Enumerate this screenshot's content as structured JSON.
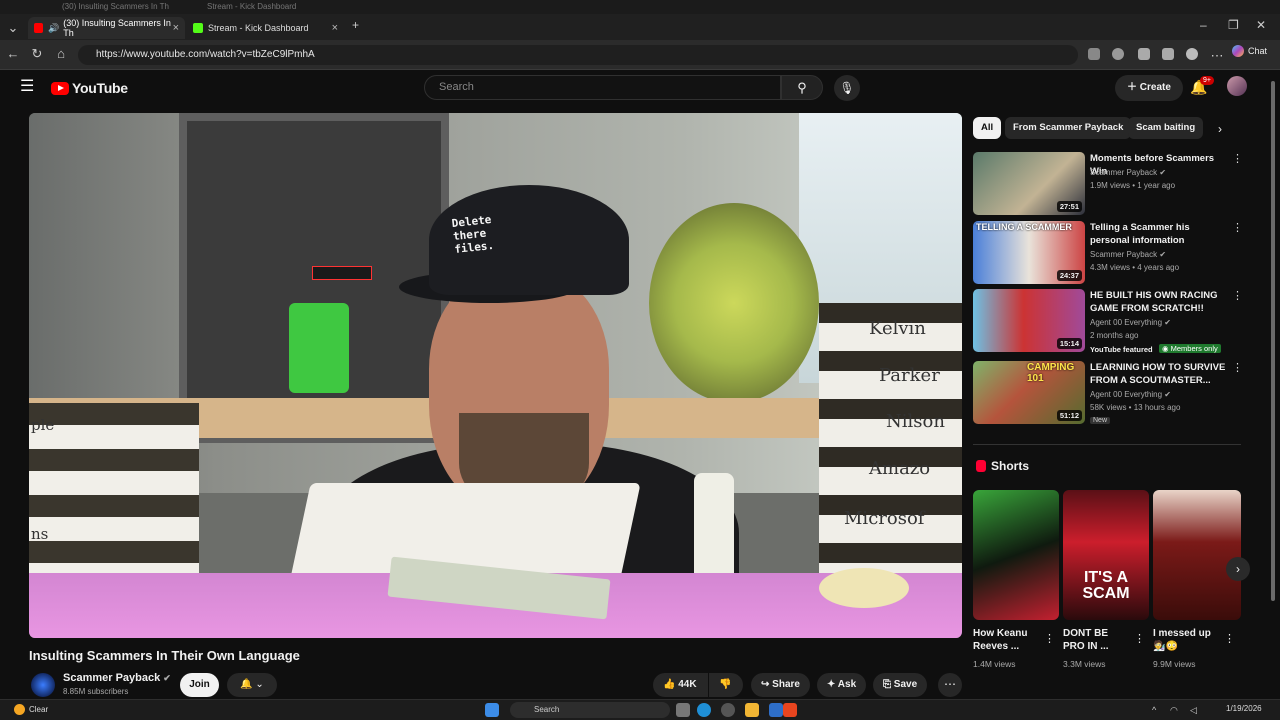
{
  "browser": {
    "tabs": [
      {
        "label": "(30) Insulting Scammers In Th",
        "active": true
      },
      {
        "label": "Stream - Kick Dashboard",
        "active": false
      }
    ],
    "ghost_tabs": [
      "(30) Insulting Scammers In Th",
      "Stream - Kick Dashboard"
    ],
    "url": "https://www.youtube.com/watch?v=tbZeC9lPmhA",
    "chat_label": "Chat"
  },
  "youtube": {
    "logo_text": "YouTube",
    "search_placeholder": "Search",
    "create_label": "Create",
    "notif_badge": "9+"
  },
  "video": {
    "title": "Insulting Scammers In Their Own Language",
    "cap_text": "Delete\nthere\nfiles.",
    "book_labels": [
      "Kelvin",
      "Parker",
      "Nilson",
      "Amazo",
      "Microsof"
    ],
    "left_labels": [
      "ple",
      "ns"
    ],
    "channel": "Scammer Payback",
    "subscribers": "8.85M subscribers",
    "join_label": "Join",
    "likes": "44K",
    "share_label": "Share",
    "ask_label": "Ask",
    "save_label": "Save"
  },
  "sidebar": {
    "chips": [
      "All",
      "From Scammer Payback",
      "Scam baiting"
    ],
    "recommendations": [
      {
        "title": "Moments before Scammers Win",
        "channel": "Scammer Payback",
        "meta": "1.9M views • 1 year ago",
        "duration": "27:51"
      },
      {
        "title": "Telling a Scammer his personal information",
        "channel": "Scammer Payback",
        "meta": "4.3M views • 4 years ago",
        "duration": "24:37"
      },
      {
        "title": "HE BUILT HIS OWN RACING GAME FROM SCRATCH!!",
        "channel": "Agent 00 Everything",
        "meta": "2 months ago",
        "duration": "15:14",
        "featured": "YouTube featured",
        "members": "Members only"
      },
      {
        "title": "LEARNING HOW TO SURVIVE FROM A SCOUTMASTER...",
        "channel": "Agent 00 Everything",
        "meta": "58K views • 13 hours ago",
        "duration": "51:12",
        "badge": "New"
      }
    ],
    "thumb_texts": [
      "TELLING A SCAMMER",
      "CAMPING 101"
    ],
    "shorts_heading": "Shorts",
    "shorts": [
      {
        "title": "How Keanu Reeves ...",
        "views": "1.4M views"
      },
      {
        "title": "DONT BE PRO IN ...",
        "views": "3.3M views",
        "overlay": "IT'S A SCAM"
      },
      {
        "title": "I messed up 🧑‍🔬😳",
        "views": "9.9M views"
      }
    ]
  },
  "taskbar": {
    "weather": "Clear",
    "search": "Search",
    "date": "1/19/2026"
  }
}
